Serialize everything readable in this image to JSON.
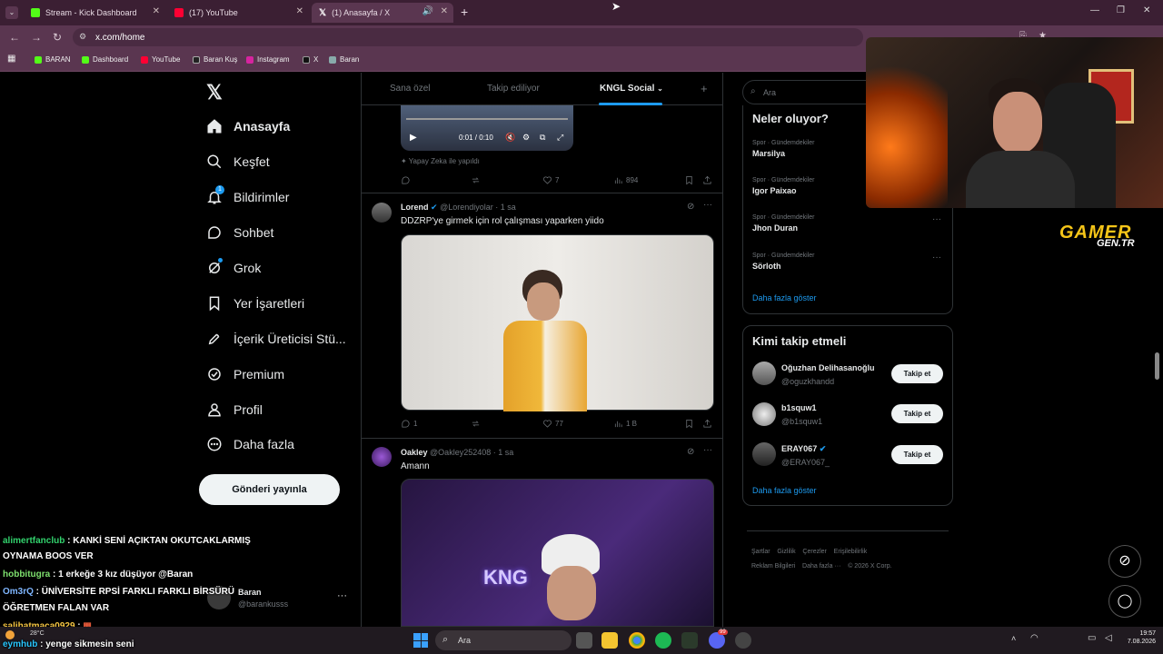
{
  "browser": {
    "tabs": [
      {
        "label": "Stream - Kick Dashboard",
        "color": "#53fc18"
      },
      {
        "label": "(17) YouTube",
        "color": "#ff0033"
      },
      {
        "label": "(1) Anasayfa / X",
        "color": "#ffffff"
      }
    ],
    "new_tab": "+",
    "url": "x.com/home",
    "bookmarks": [
      "BARAN",
      "Dashboard",
      "YouTube",
      "Baran Kuş",
      "Instagram",
      "X",
      "Baran"
    ]
  },
  "nav": {
    "items": [
      "Anasayfa",
      "Keşfet",
      "Bildirimler",
      "Sohbet",
      "Grok",
      "Yer İşaretleri",
      "İçerik Üreticisi Stü...",
      "Premium",
      "Profil",
      "Daha fazla"
    ],
    "notif_badge": "1",
    "post_button": "Gönderi yayınla",
    "account_name": "Baran",
    "account_handle": "@barankusss"
  },
  "feed": {
    "tabs": [
      "Sana özel",
      "Takip ediliyor",
      "KNGL Social"
    ],
    "add_tab": "+",
    "video": {
      "time": "0:01 / 0:10"
    },
    "ai_note": "Yapay Zeka ile yapıldı",
    "post0_stats": {
      "reply": "",
      "repost": "",
      "like": "7",
      "views": "894"
    },
    "posts": [
      {
        "name": "Lorend",
        "handle": "@Lorendiyolar",
        "time": "· 1 sa",
        "text": "DDZRP'ye girmek için rol çalışması yaparken yiido",
        "replies": "1",
        "reposts": "",
        "likes": "77",
        "views": "1 B"
      },
      {
        "name": "Oakley",
        "handle": "@Oakley252408",
        "time": "· 1 sa",
        "text": "Amann"
      }
    ]
  },
  "right": {
    "search_placeholder": "Ara",
    "trends_title": "Neler oluyor?",
    "trends": [
      {
        "category": "Spor · Gündemdekiler",
        "title": "Marsilya"
      },
      {
        "category": "Spor · Gündemdekiler",
        "title": "Igor Paixao"
      },
      {
        "category": "Spor · Gündemdekiler",
        "title": "Jhon Duran"
      },
      {
        "category": "Spor · Gündemdekiler",
        "title": "Sörloth"
      }
    ],
    "trends_more": "Daha fazla göster",
    "who_title": "Kimi takip etmeli",
    "who": [
      {
        "name": "Oğuzhan Delihasanoğlu",
        "handle": "@oguzkhandd",
        "button": "Takip et"
      },
      {
        "name": "b1squw1",
        "handle": "@b1squw1",
        "button": "Takip et"
      },
      {
        "name": "ERAY067",
        "handle": "@ERAY067_",
        "button": "Takip et"
      }
    ],
    "who_more": "Daha fazla göster",
    "footer": [
      "Şartlar",
      "Gizlilik",
      "Çerezler",
      "Erişilebilirlik",
      "Reklam Bilgileri",
      "Daha fazla ···",
      "© 2026 X Corp."
    ]
  },
  "overlay": {
    "brand_line1": "GAMER",
    "brand_line2": "GEN.TR",
    "chat": [
      {
        "user": "alimertfanclub",
        "msg": "KANKİ SENİ AÇIKTAN OKUTCAKLARMIŞ"
      },
      {
        "user": "",
        "msg": "OYNAMA BOOS VER"
      },
      {
        "user": "hobbitugra",
        "msg": "1 erkeğe 3 kız düşüyor @Baran"
      },
      {
        "user": "Om3rQ",
        "msg": "ÜNİVERSİTE RPSİ FARKLI FARKLI BİRSÜRÜ"
      },
      {
        "user": "",
        "msg": "ÖĞRETMEN FALAN VAR"
      },
      {
        "user": "salihatmaca0929",
        "msg": ""
      },
      {
        "user": "eymhub",
        "msg": "yenge sikmesin seni"
      }
    ]
  },
  "taskbar": {
    "search": "Ara",
    "temp": "28°C",
    "time": "19:57",
    "date": "7.08.2026",
    "discord_badge": "99"
  }
}
